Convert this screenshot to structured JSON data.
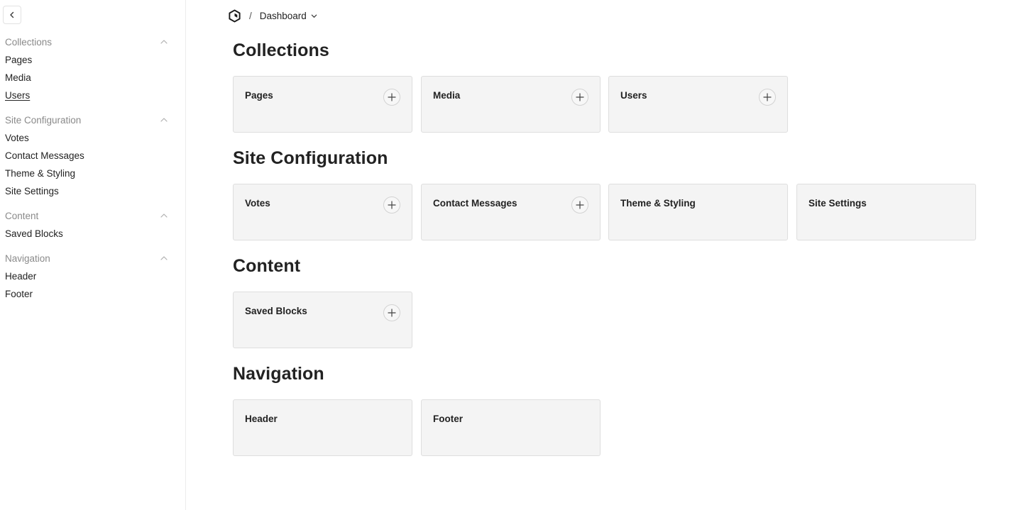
{
  "sidebar": {
    "groups": [
      {
        "title": "Collections",
        "items": [
          {
            "label": "Pages"
          },
          {
            "label": "Media"
          },
          {
            "label": "Users"
          }
        ]
      },
      {
        "title": "Site Configuration",
        "items": [
          {
            "label": "Votes"
          },
          {
            "label": "Contact Messages"
          },
          {
            "label": "Theme & Styling"
          },
          {
            "label": "Site Settings"
          }
        ]
      },
      {
        "title": "Content",
        "items": [
          {
            "label": "Saved Blocks"
          }
        ]
      },
      {
        "title": "Navigation",
        "items": [
          {
            "label": "Header"
          },
          {
            "label": "Footer"
          }
        ]
      }
    ],
    "active_item": "Users"
  },
  "breadcrumb": {
    "separator": "/",
    "current": "Dashboard"
  },
  "sections": [
    {
      "title": "Collections",
      "cards": [
        {
          "label": "Pages",
          "add": true
        },
        {
          "label": "Media",
          "add": true
        },
        {
          "label": "Users",
          "add": true
        }
      ]
    },
    {
      "title": "Site Configuration",
      "cards": [
        {
          "label": "Votes",
          "add": true
        },
        {
          "label": "Contact Messages",
          "add": true
        },
        {
          "label": "Theme & Styling",
          "add": false
        },
        {
          "label": "Site Settings",
          "add": false
        }
      ]
    },
    {
      "title": "Content",
      "cards": [
        {
          "label": "Saved Blocks",
          "add": true
        }
      ]
    },
    {
      "title": "Navigation",
      "cards": [
        {
          "label": "Header",
          "add": false
        },
        {
          "label": "Footer",
          "add": false
        }
      ]
    }
  ],
  "icons": {
    "collapse": "chevron-left-icon",
    "group_toggle": "chevron-up-icon",
    "logo": "app-logo-icon",
    "breadcrumb_dropdown": "chevron-down-icon",
    "card_add": "plus-icon"
  },
  "colors": {
    "card_background": "#f4f4f4",
    "card_border": "#dedede",
    "muted_text": "#8a8a8a",
    "text": "#222222"
  }
}
